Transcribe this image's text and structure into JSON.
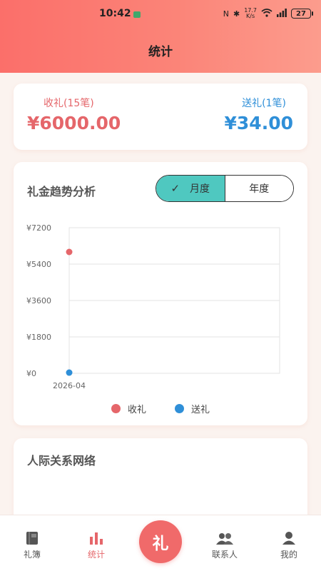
{
  "status": {
    "time": "10:42",
    "speed": "17.7\nK/s",
    "battery": "27"
  },
  "header": {
    "title": "统计"
  },
  "summary": {
    "received_label": "收礼(15笔)",
    "received_value": "¥6000.00",
    "sent_label": "送礼(1笔)",
    "sent_value": "¥34.00"
  },
  "trend": {
    "title": "礼金趋势分析",
    "toggle": [
      {
        "label": "月度",
        "active": true
      },
      {
        "label": "年度",
        "active": false
      }
    ]
  },
  "chart_data": {
    "type": "scatter",
    "categories": [
      "2026-04"
    ],
    "y_tick_labels": [
      "¥7200",
      "¥5400",
      "¥3600",
      "¥1800",
      "¥0"
    ],
    "ylim": [
      0,
      7200
    ],
    "grid": true,
    "legend_placement": "bottom",
    "series": [
      {
        "name": "收礼",
        "color": "#e5666a",
        "values": [
          6000
        ]
      },
      {
        "name": "送礼",
        "color": "#2f8fd8",
        "values": [
          34
        ]
      }
    ]
  },
  "network": {
    "title": "人际关系网络"
  },
  "nav": {
    "items": [
      {
        "label": "礼簿",
        "icon": "book-icon"
      },
      {
        "label": "统计",
        "icon": "bar-chart-icon"
      },
      {
        "label": "礼",
        "icon": "gift-center-button"
      },
      {
        "label": "联系人",
        "icon": "contacts-icon"
      },
      {
        "label": "我的",
        "icon": "user-icon"
      }
    ]
  },
  "colors": {
    "accent_red": "#e5666a",
    "accent_blue": "#2f8fd8",
    "toggle_active": "#4fc8c0",
    "header_start": "#fb6f6a",
    "header_end": "#fc9c8d"
  }
}
